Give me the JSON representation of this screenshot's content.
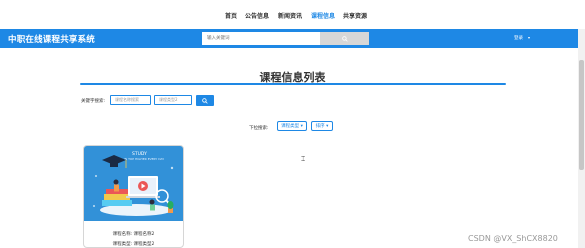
{
  "nav": {
    "items": [
      {
        "label": "首页",
        "active": false
      },
      {
        "label": "公告信息",
        "active": false
      },
      {
        "label": "新闻资讯",
        "active": false
      },
      {
        "label": "课程信息",
        "active": true
      },
      {
        "label": "共享资源",
        "active": false
      }
    ]
  },
  "header": {
    "site_title": "中职在线课程共享系统",
    "search_placeholder": "输入关键词",
    "user_label": "登录"
  },
  "page": {
    "title": "课程信息列表"
  },
  "filters": {
    "keyword_label": "关键字搜索:",
    "name_placeholder": "课程名称搜索",
    "type_placeholder": "课程类型2",
    "dropdown_label": "下拉搜索:",
    "type_dropdown": "课程类型 ▾",
    "sort_dropdown": "排序 ▾"
  },
  "courses": [
    {
      "cover_text_line1": "STUDY",
      "cover_text_line2": "IN TOP HIGHER EVERY DAY",
      "name_line": "课程名称: 课程名称2",
      "type_line": "课程类型: 课程类型2"
    }
  ],
  "watermark": "CSDN @VX_ShCX8820",
  "colors": {
    "accent": "#1e88e5",
    "header_bg": "#1e88e5",
    "search_button_bg": "#d7d7d7",
    "card_cover_bg": "#2d8ad3"
  }
}
